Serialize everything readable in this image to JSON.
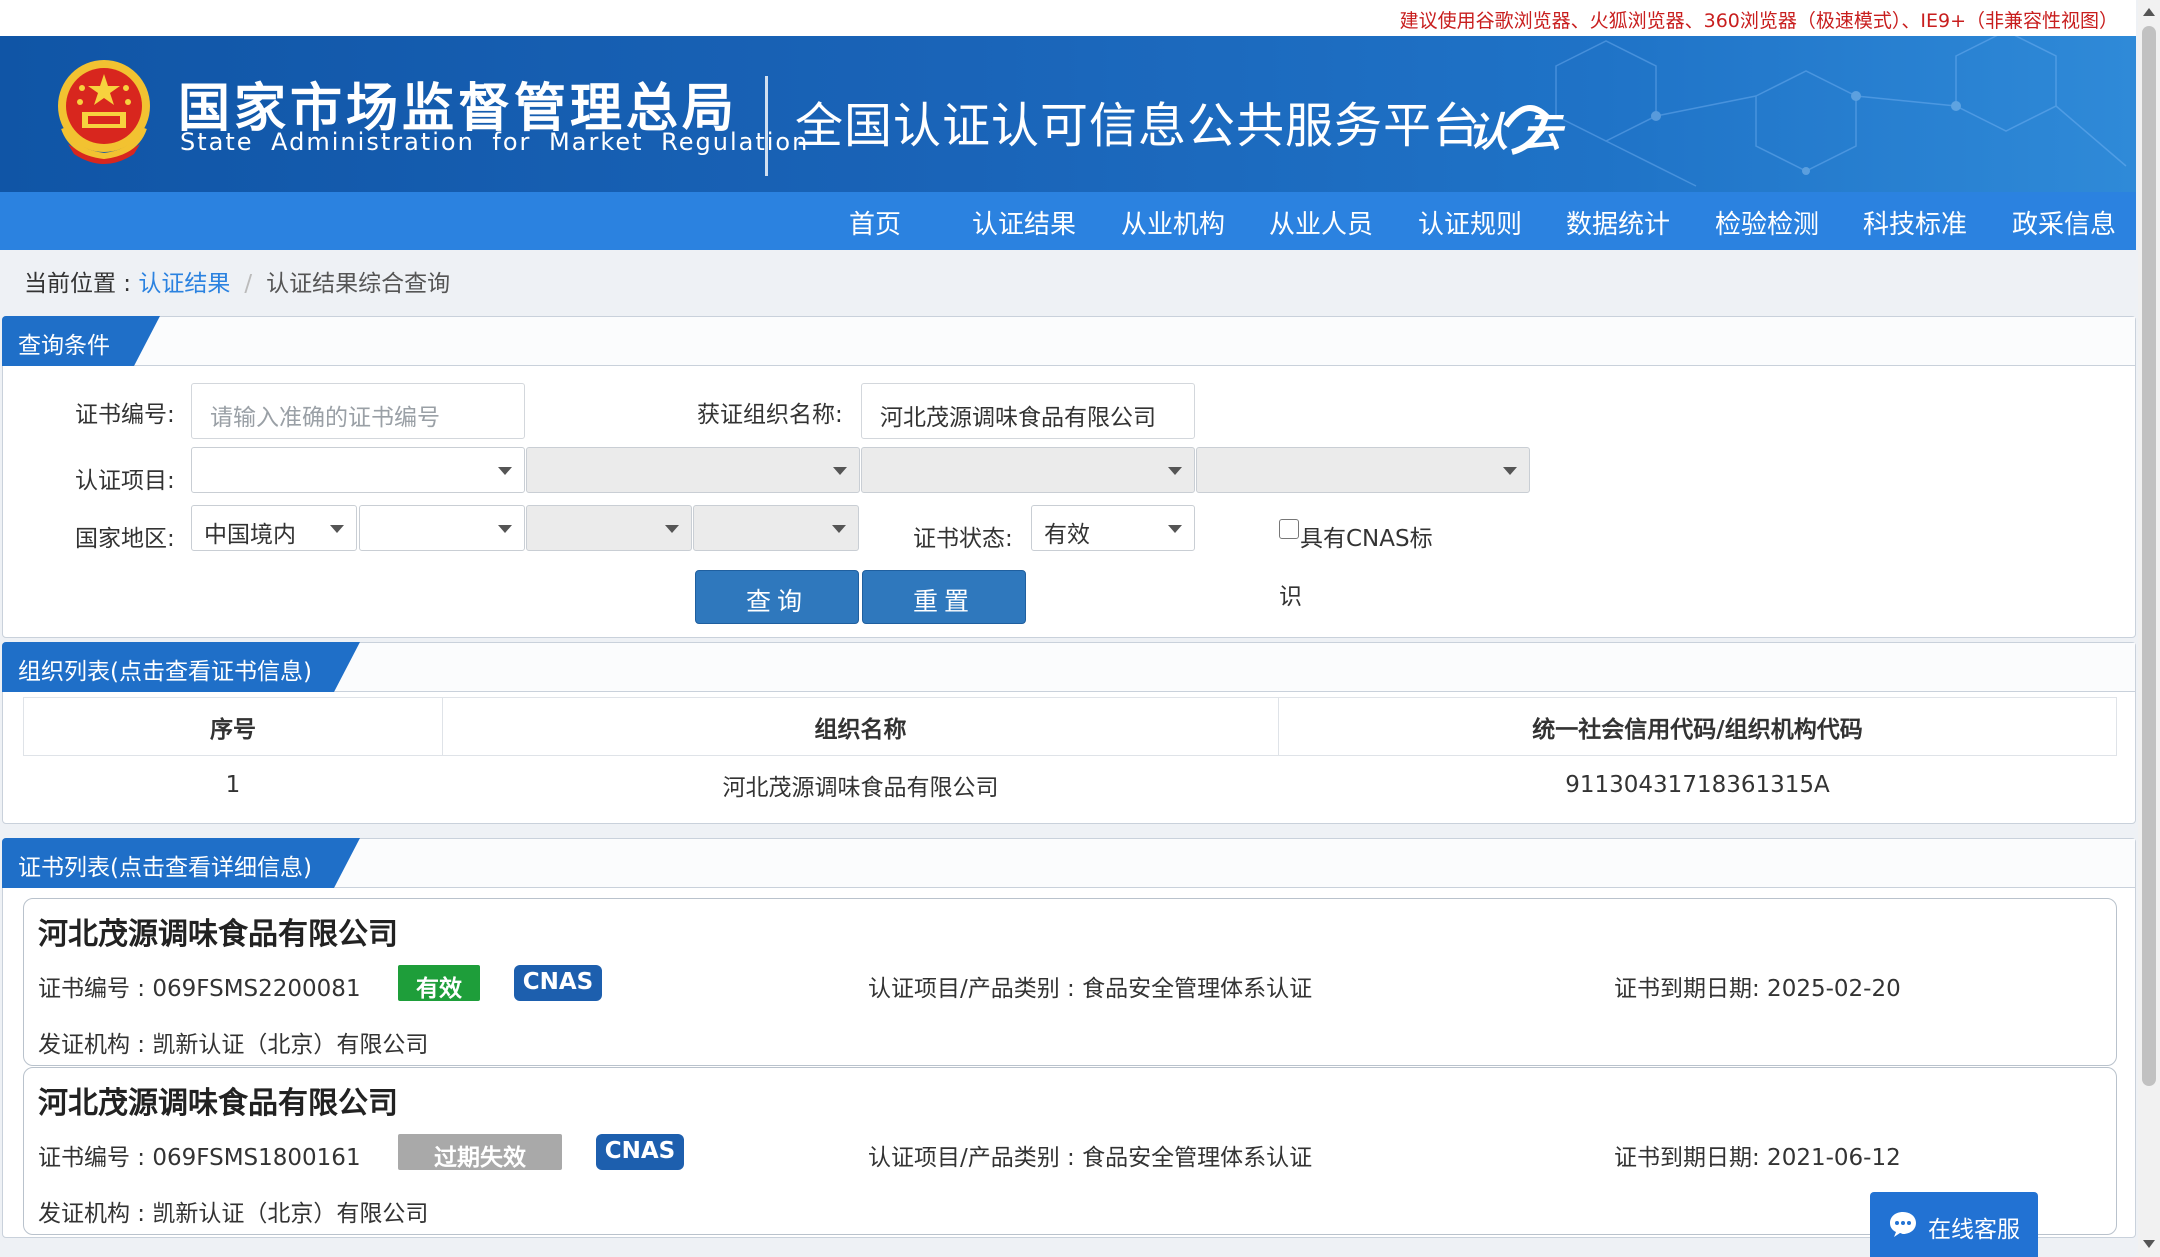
{
  "notice": "建议使用谷歌浏览器、火狐浏览器、360浏览器（极速模式）、IE9+（非兼容性视图）",
  "header": {
    "org_cn": "国家市场监督管理总局",
    "org_en": "State Administration for Market Regulation",
    "platform": "全国认证认可信息公共服务平台",
    "logo_text": "认 云"
  },
  "nav": [
    "首页",
    "认证结果",
    "从业机构",
    "从业人员",
    "认证规则",
    "数据统计",
    "检验检测",
    "科技标准",
    "政采信息"
  ],
  "breadcrumb": {
    "prefix": "当前位置 : ",
    "link": "认证结果",
    "sep": "/",
    "current": "认证结果综合查询"
  },
  "query": {
    "title": "查询条件",
    "cert_no_label": "证书编号:",
    "cert_no_placeholder": "请输入准确的证书编号",
    "org_name_label": "获证组织名称:",
    "org_name_value": "河北茂源调味食品有限公司",
    "project_label": "认证项目:",
    "region_label": "国家地区:",
    "region_value": "中国境内",
    "status_label": "证书状态:",
    "status_value": "有效",
    "cnas_label_1": "具有CNAS标",
    "cnas_label_2": "识",
    "search_button": "查询",
    "reset_button": "重置"
  },
  "orgs": {
    "title": "组织列表(点击查看证书信息)",
    "headers": [
      "序号",
      "组织名称",
      "统一社会信用代码/组织机构代码"
    ],
    "rows": [
      [
        "1",
        "河北茂源调味食品有限公司",
        "91130431718361315A"
      ]
    ]
  },
  "certs": {
    "title": "证书列表(点击查看详细信息)",
    "items": [
      {
        "org": "河北茂源调味食品有限公司",
        "cert_no": "证书编号 : 069FSMS2200081",
        "status": "有效",
        "status_color": "#1e9e3a",
        "cnas": "CNAS",
        "project": "认证项目/产品类别 : 食品安全管理体系认证",
        "expiry": "证书到期日期: 2025-02-20",
        "issuer": "发证机构 : 凯新认证（北京）有限公司"
      },
      {
        "org": "河北茂源调味食品有限公司",
        "cert_no": "证书编号 : 069FSMS1800161",
        "status": "过期失效",
        "status_color": "#a9a9a9",
        "cnas": "CNAS",
        "project": "认证项目/产品类别 : 食品安全管理体系认证",
        "expiry": "证书到期日期: 2021-06-12",
        "issuer": "发证机构 : 凯新认证（北京）有限公司"
      }
    ]
  },
  "chat": "在线客服",
  "colors": {
    "nav": "#2b82e0",
    "header": "#1055a6",
    "tab": "#1f6fc8",
    "button": "#2f78bd",
    "cnas": "#1d5fae"
  }
}
